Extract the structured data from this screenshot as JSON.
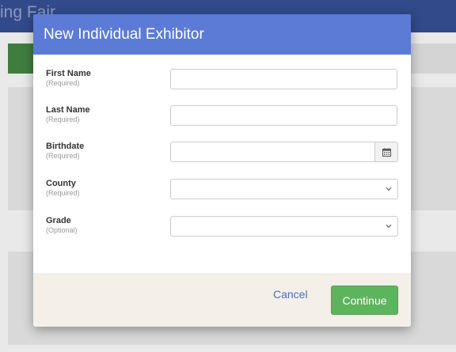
{
  "background": {
    "title_fragment": "ing Fair"
  },
  "modal": {
    "title": "New Individual Exhibitor",
    "fields": [
      {
        "label": "First Name",
        "hint": "(Required)",
        "type": "text",
        "value": ""
      },
      {
        "label": "Last Name",
        "hint": "(Required)",
        "type": "text",
        "value": ""
      },
      {
        "label": "Birthdate",
        "hint": "(Required)",
        "type": "date",
        "value": ""
      },
      {
        "label": "County",
        "hint": "(Required)",
        "type": "select",
        "value": ""
      },
      {
        "label": "Grade",
        "hint": "(Optional)",
        "type": "select",
        "value": ""
      }
    ],
    "cancel_label": "Cancel",
    "continue_label": "Continue"
  },
  "colors": {
    "header": "#5b7bd6",
    "continue": "#5cb45c",
    "cancel_link": "#4a6ec2"
  },
  "icons": {
    "birthdate_picker": "calendar-icon",
    "select_arrow": "chevron-down-icon"
  }
}
